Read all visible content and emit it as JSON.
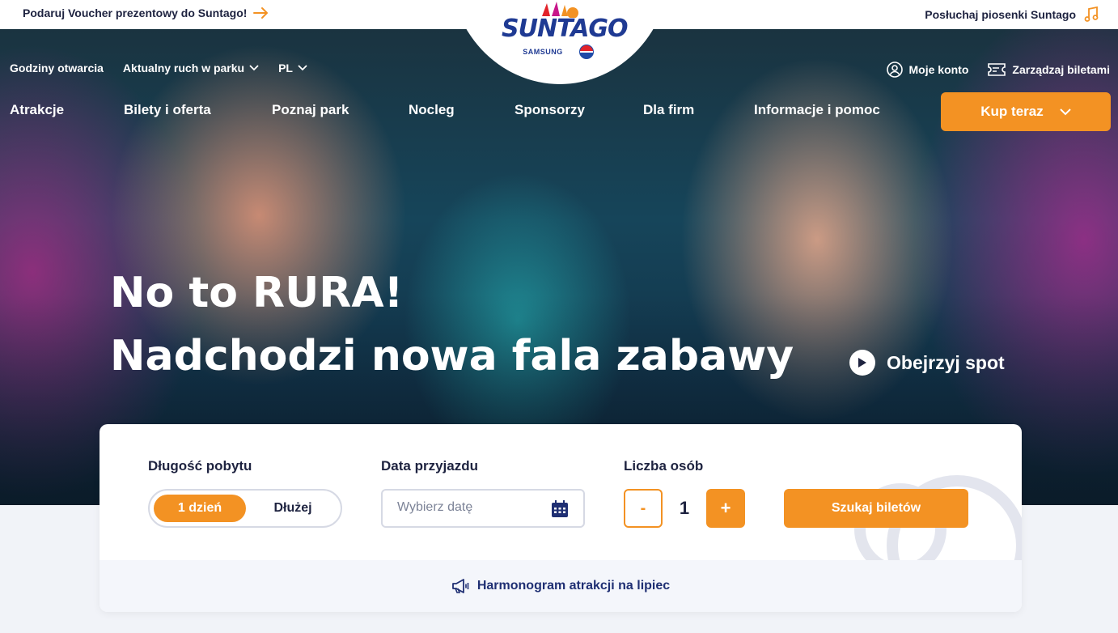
{
  "topbar": {
    "voucher_text": "Podaruj Voucher prezentowy do Suntago!",
    "voucher_icon": "arrow-right-icon",
    "song_text": "Posłuchaj piosenki Suntago",
    "song_icon": "music-note-icon"
  },
  "logo": {
    "brand": "SUNTAGO",
    "sponsor_1": "SAMSUNG",
    "sponsor_2": "PEPSI"
  },
  "subnav": {
    "hours": "Godziny otwarcia",
    "traffic": "Aktualny ruch w parku",
    "language": "PL"
  },
  "account": {
    "my_account": "Moje konto",
    "manage_tickets": "Zarządzaj biletami"
  },
  "mainnav": {
    "items": [
      "Atrakcje",
      "Bilety i oferta",
      "Poznaj park",
      "Nocleg",
      "Sponsorzy",
      "Dla firm",
      "Informacje i pomoc"
    ],
    "buy_label": "Kup teraz"
  },
  "hero": {
    "line1": "No to RURA!",
    "line2": "Nadchodzi nowa fala zabawy",
    "spot_label": "Obejrzyj spot"
  },
  "booking": {
    "stay_label": "Długość pobytu",
    "stay_options": [
      "1 dzień",
      "Dłużej"
    ],
    "stay_selected": "1 dzień",
    "date_label": "Data przyjazdu",
    "date_placeholder": "Wybierz datę",
    "people_label": "Liczba osób",
    "minus": "-",
    "people_count": "1",
    "plus": "+",
    "search_label": "Szukaj biletów",
    "schedule_link": "Harmonogram atrakcji na lipiec"
  },
  "colors": {
    "accent": "#f39223",
    "navy": "#1e2340",
    "link": "#1f2f73"
  }
}
